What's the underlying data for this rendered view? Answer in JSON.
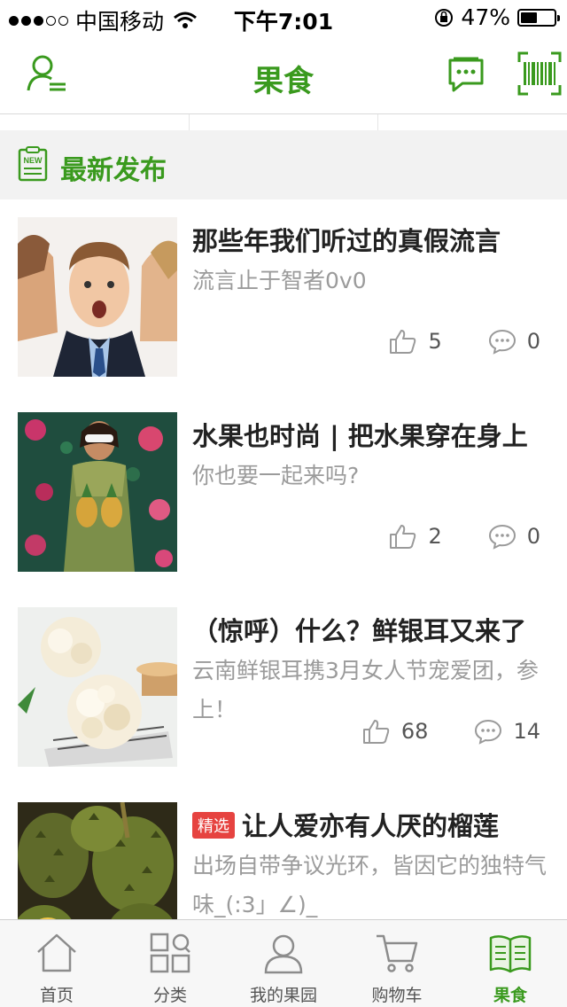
{
  "status_bar": {
    "carrier": "中国移动",
    "time": "下午7:01",
    "battery": "47%",
    "battery_level": 0.47,
    "signal_bars": 3
  },
  "header": {
    "title": "果食",
    "icons": [
      "profile-icon",
      "message-icon",
      "barcode-scan-icon"
    ]
  },
  "section": {
    "title": "最新发布",
    "icon": "new-badge-icon"
  },
  "articles": [
    {
      "title": "那些年我们听过的真假流言",
      "desc": "流言止于智者0v0",
      "likes": "5",
      "comments": "0",
      "badge": ""
    },
    {
      "title": "水果也时尚 | 把水果穿在身上",
      "desc": "你也要一起来吗?",
      "likes": "2",
      "comments": "0",
      "badge": ""
    },
    {
      "title": "（惊呼）什么？鲜银耳又来了",
      "desc": "云南鲜银耳携3月女人节宠爱团，参上！",
      "likes": "68",
      "comments": "14",
      "badge": ""
    },
    {
      "title": "让人爱亦有人厌的榴莲",
      "desc": "出场自带争议光环，皆因它的独特气味_(:3」∠)_",
      "likes": "",
      "comments": "",
      "badge": "精选"
    }
  ],
  "tabbar": {
    "tabs": [
      {
        "label": "首页",
        "icon": "home-icon"
      },
      {
        "label": "分类",
        "icon": "category-icon"
      },
      {
        "label": "我的果园",
        "icon": "user-icon"
      },
      {
        "label": "购物车",
        "icon": "cart-icon"
      },
      {
        "label": "果食",
        "icon": "book-icon"
      }
    ],
    "active": "果食"
  },
  "colors": {
    "accent": "#3a9a1e",
    "badge": "#e64340",
    "muted": "#9b9b9b"
  }
}
